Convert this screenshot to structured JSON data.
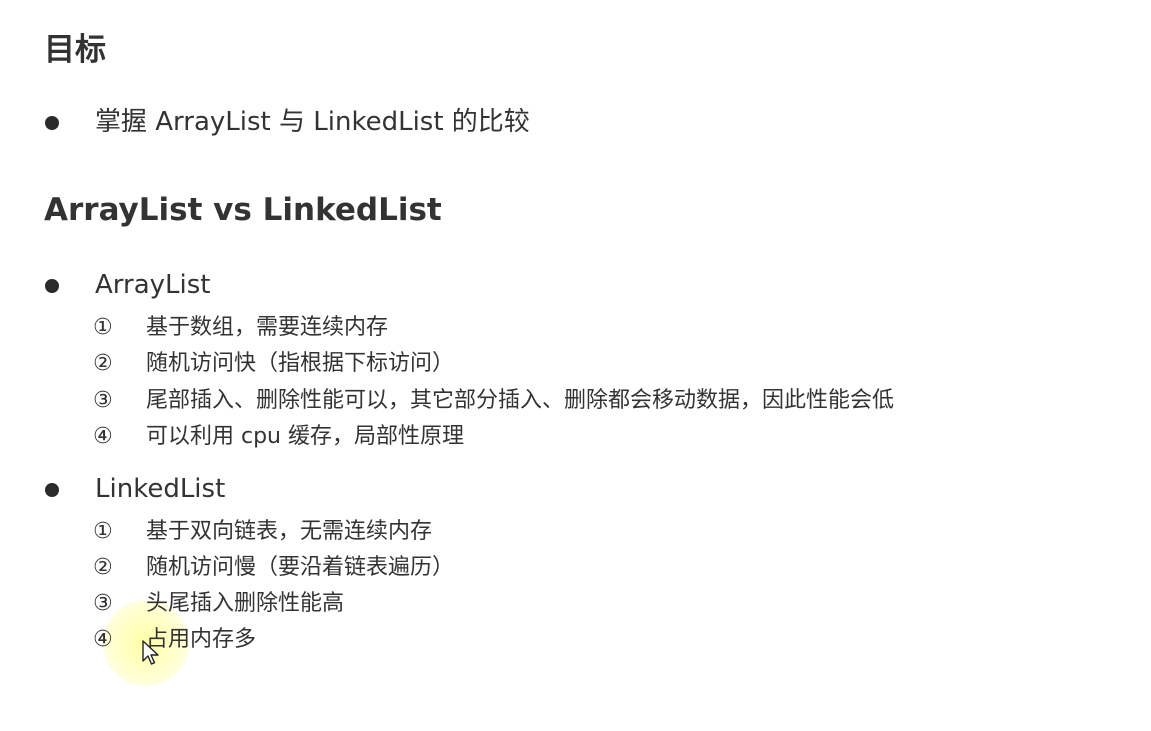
{
  "heading1": "目标",
  "goal": {
    "text": "掌握 ArrayList 与 LinkedList 的比较"
  },
  "heading2": "ArrayList vs LinkedList",
  "arraylist": {
    "title": "ArrayList",
    "items": [
      {
        "num": "①",
        "text": "基于数组，需要连续内存"
      },
      {
        "num": "②",
        "text": "随机访问快（指根据下标访问）"
      },
      {
        "num": "③",
        "text": "尾部插入、删除性能可以，其它部分插入、删除都会移动数据，因此性能会低"
      },
      {
        "num": "④",
        "text": "可以利用 cpu 缓存，局部性原理"
      }
    ]
  },
  "linkedlist": {
    "title": "LinkedList",
    "items": [
      {
        "num": "①",
        "text": "基于双向链表，无需连续内存"
      },
      {
        "num": "②",
        "text": "随机访问慢（要沿着链表遍历）"
      },
      {
        "num": "③",
        "text": "头尾插入删除性能高"
      },
      {
        "num": "④",
        "text": "占用内存多"
      }
    ]
  },
  "colors": {
    "text": "#333333",
    "bullet": "#2b2b2b",
    "cursor_highlight": "#ffff99"
  }
}
